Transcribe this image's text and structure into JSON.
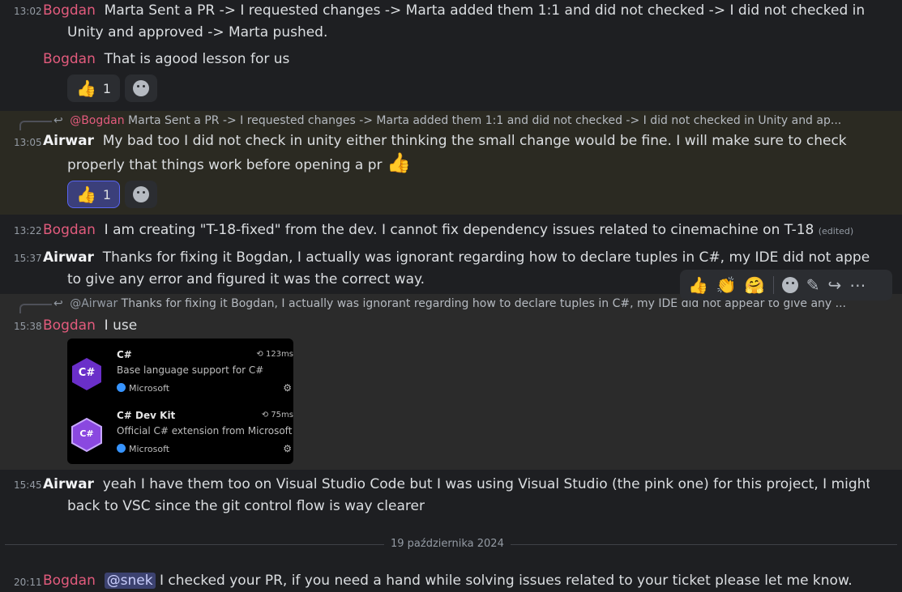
{
  "messages": [
    {
      "time": "13:02",
      "author": "Bogdan",
      "text1": "Marta Sent a PR -> I requested changes -> Marta added them 1:1 and did not checked -> I did not checked in",
      "text2": "Unity and approved -> Marta pushed."
    },
    {
      "author": "Bogdan",
      "text": "That is agood lesson for us",
      "reaction_count": "1"
    },
    {
      "reply_to": "@Bogdan",
      "reply_text": "Marta Sent a PR -> I requested changes -> Marta added them 1:1 and did not checked -> I did not checked in Unity and ap...",
      "time": "13:05",
      "author": "Airwar",
      "text1": "My bad too I did not check in unity either thinking the small change would be fine. I will make sure to check",
      "text2": "properly that things work before opening a pr",
      "reaction_count": "1"
    },
    {
      "time": "13:22",
      "author": "Bogdan",
      "text": "I am creating \"T-18-fixed\" from the dev. I cannot fix dependency issues related to cinemachine on T-18",
      "edited": "(edited)"
    },
    {
      "time": "15:37",
      "author": "Airwar",
      "text1": "Thanks for fixing it Bogdan, I actually was ignorant regarding how to declare tuples in C#, my IDE did not appear",
      "text2": "to give any error and figured it was the correct way."
    },
    {
      "reply_to": "@Airwar",
      "reply_text": "Thanks for fixing it Bogdan, I actually was ignorant regarding how to declare tuples in C#, my IDE did not appear to give any ...",
      "time": "15:38",
      "author": "Bogdan",
      "text": "I use"
    },
    {
      "time": "15:45",
      "author": "Airwar",
      "text1": "yeah I have them too on Visual Studio Code but I was using Visual Studio (the pink one) for this project, I might go",
      "text2": "back to VSC since the git control flow is way clearer"
    },
    {
      "time": "20:11",
      "author": "Bogdan",
      "mention": "@snek",
      "text": "I checked your PR, if you need a hand while solving issues related to your ticket please let me know."
    }
  ],
  "extensions": [
    {
      "icon_text": "C#",
      "name": "C#",
      "time": "123ms",
      "desc": "Base language support for C#",
      "publisher": "Microsoft",
      "color": "#6a2fc9"
    },
    {
      "icon_text": "C#",
      "name": "C# Dev Kit",
      "time": "75ms",
      "desc": "Official C# extension from Microsoft",
      "publisher": "Microsoft",
      "color": "#8a48e0"
    }
  ],
  "date_divider": "19 października 2024",
  "icons": {
    "reply_arrow": "reply-icon",
    "thumbs": "thumbs-up-emoji",
    "clap": "clapping-hands-emoji",
    "hug": "hugging-face-emoji"
  }
}
